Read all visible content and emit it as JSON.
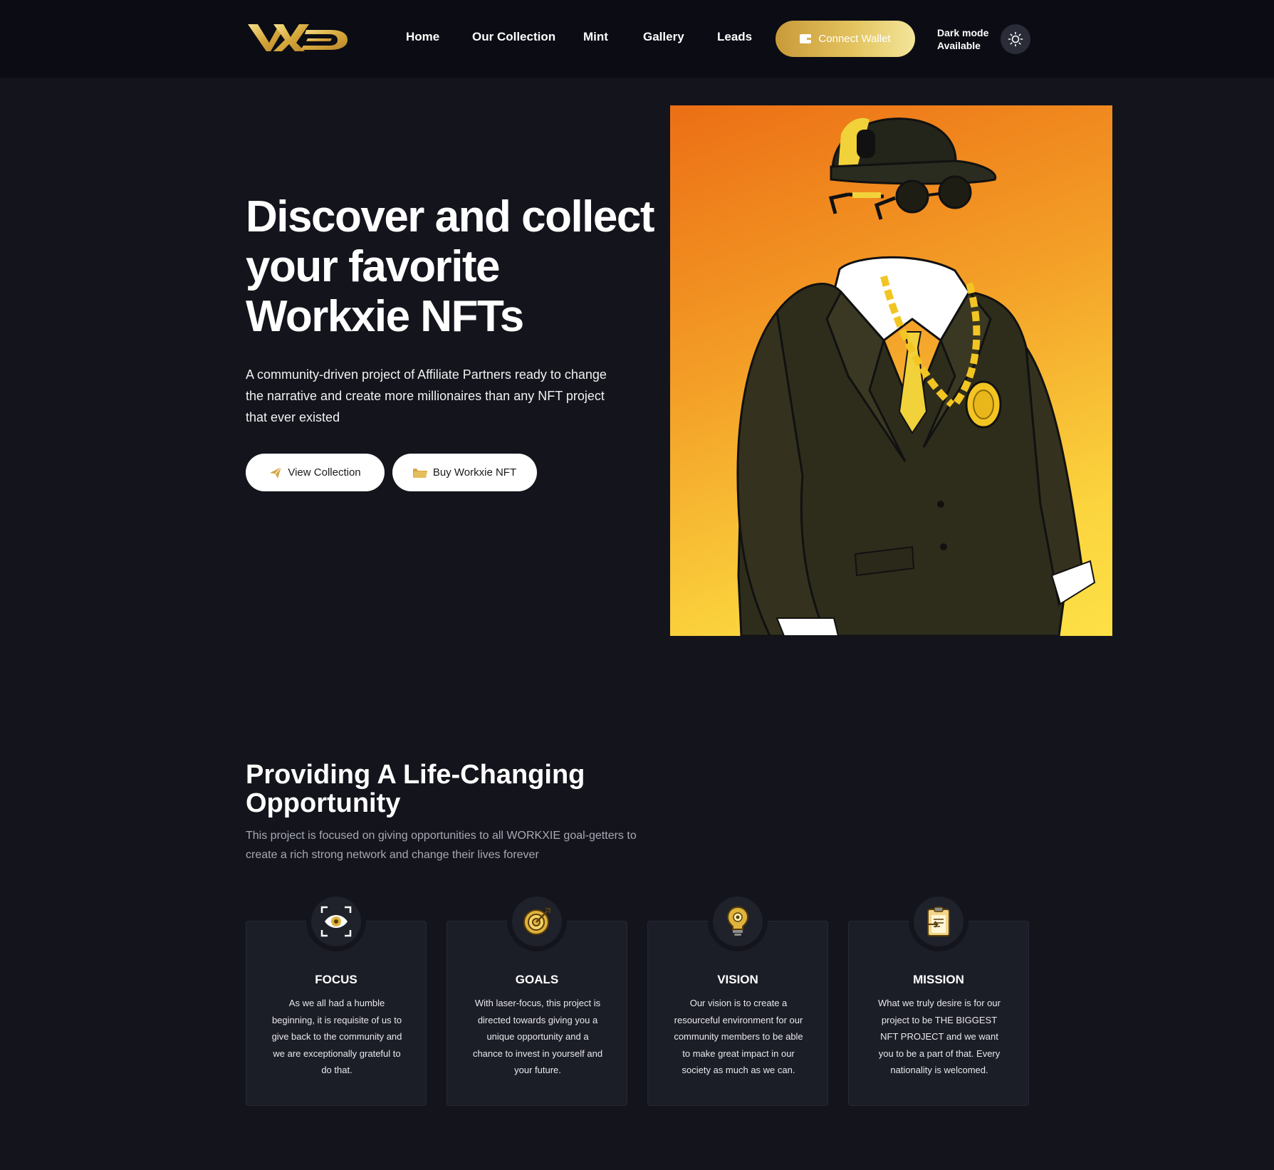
{
  "nav": {
    "logo_alt": "WX",
    "links": [
      "Home",
      "Our Collection",
      "Mint",
      "Gallery",
      "Leads"
    ],
    "connect_wallet": "Connect Wallet",
    "dark_mode_line1": "Dark mode",
    "dark_mode_line2": "Available",
    "theme_icon": "sun-icon"
  },
  "hero": {
    "title_line1": "Discover and collect",
    "title_line2": "your favorite",
    "title_line3": "Workxie NFTs",
    "description": "A community-driven project of Affiliate Partners ready to change the narrative and create more millionaires than any NFT project that ever existed",
    "view_collection": "View Collection",
    "buy_nft": "Buy Workxie NFT",
    "view_icon": "paper-plane-icon",
    "buy_icon": "folder-icon"
  },
  "section": {
    "title_line1": "Providing A Life-Changing",
    "title_line2": "Opportunity",
    "description": "This project is focused on giving opportunities to all WORKXIE goal-getters to create a rich strong network and change their lives forever"
  },
  "cards": [
    {
      "icon": "eye-icon",
      "title": "FOCUS",
      "text": "As we all had a humble beginning, it is requisite of us to give back to the community and we are exceptionally grateful to do that."
    },
    {
      "icon": "target-icon",
      "title": "GOALS",
      "text": "With laser-focus, this project is directed towards giving you a unique opportunity and a chance to invest in yourself and your future."
    },
    {
      "icon": "lightbulb-icon",
      "title": "VISION",
      "text": "Our vision is to create a resourceful environment for our community members to be able to make great impact in our society as much as we can."
    },
    {
      "icon": "clipboard-icon",
      "title": "MISSION",
      "text": "What we truly desire is for our project to be THE BIGGEST NFT PROJECT and we want you to be a part of that. Every nationality is welcomed."
    }
  ],
  "colors": {
    "background": "#13141c",
    "nav_background": "#0c0d14",
    "accent_gold": "#d9b24a",
    "card_background": "#1c1e27"
  }
}
